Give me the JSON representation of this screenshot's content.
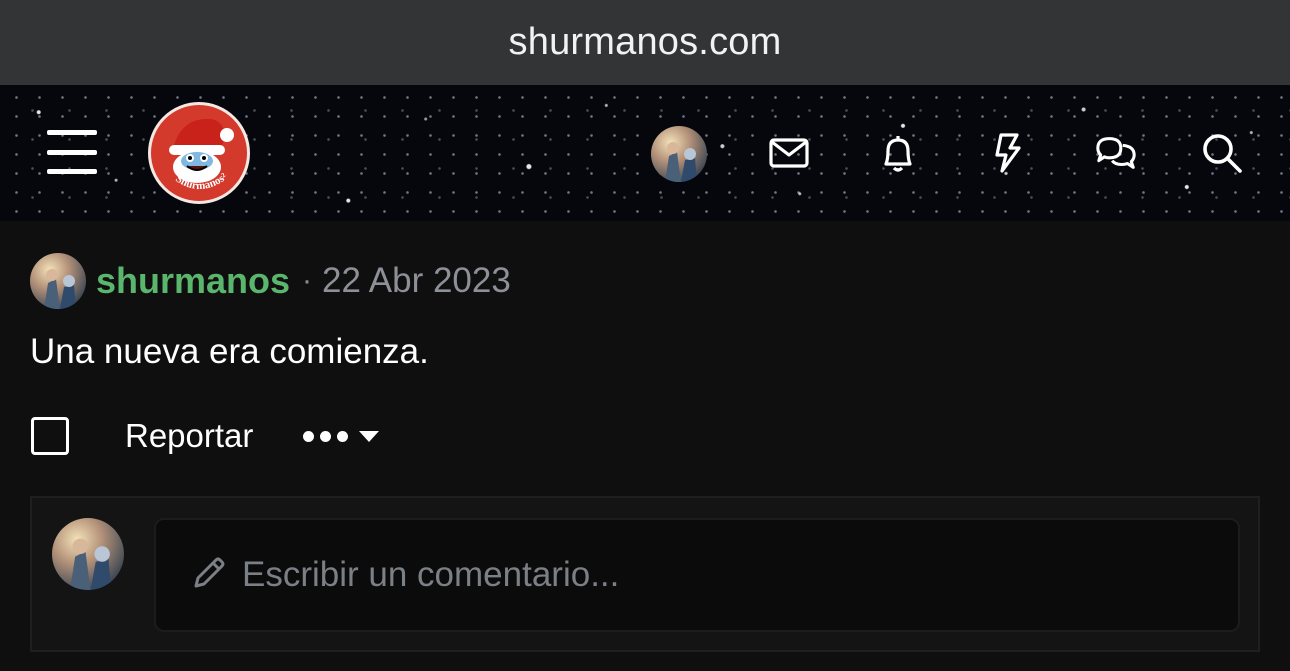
{
  "browser": {
    "url": "shurmanos.com"
  },
  "header": {
    "logo_text": "Shurmanos²",
    "icons": [
      "menu-icon",
      "mail-icon",
      "bell-icon",
      "bolt-icon",
      "chat-bubbles-icon",
      "search-icon"
    ]
  },
  "post": {
    "author": "shurmanos",
    "separator": "·",
    "date": "22 Abr 2023",
    "text": "Una nueva era comienza.",
    "actions": {
      "report_label": "Reportar",
      "more_icon": "ellipsis-icon"
    }
  },
  "comment": {
    "placeholder": "Escribir un comentario...",
    "icon": "pencil-icon"
  },
  "colors": {
    "username": "#5ab56d",
    "background": "#0f0f0f",
    "urlbar": "#333436",
    "logo_red": "#d33a2c"
  }
}
